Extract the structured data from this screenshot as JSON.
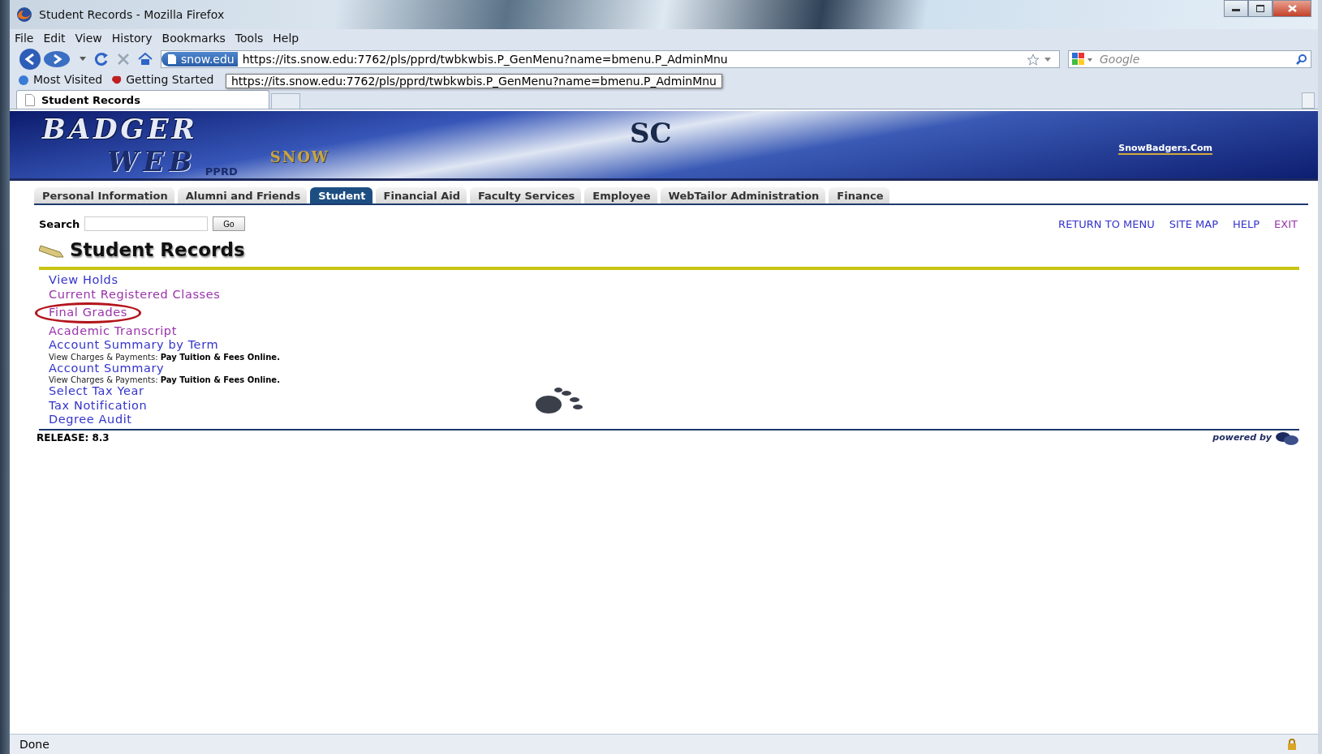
{
  "window": {
    "title": "Student Records - Mozilla Firefox"
  },
  "menu": [
    "File",
    "Edit",
    "View",
    "History",
    "Bookmarks",
    "Tools",
    "Help"
  ],
  "toolbar": {
    "site_badge": "snow.edu",
    "url": "https://its.snow.edu:7762/pls/pprd/twbkwbis.P_GenMenu?name=bmenu.P_AdminMnu",
    "search_placeholder": "Google"
  },
  "bookmarks": [
    "Most Visited",
    "Getting Started"
  ],
  "tooltip": "https://its.snow.edu:7762/pls/pprd/twbkwbis.P_GenMenu?name=bmenu.P_AdminMnu",
  "browser_tabs": [
    {
      "label": "Student Records",
      "selected": true
    }
  ],
  "banner": {
    "logo_line_1": "BADGER",
    "logo_line_2": "WEB",
    "instance": "PPRD",
    "brand": "SNOW",
    "emblem": "SC",
    "site_link": "SnowBadgers.Com"
  },
  "page_tabs": [
    {
      "label": "Personal Information",
      "selected": false
    },
    {
      "label": "Alumni and Friends",
      "selected": false
    },
    {
      "label": "Student",
      "selected": true
    },
    {
      "label": "Financial Aid",
      "selected": false
    },
    {
      "label": "Faculty Services",
      "selected": false
    },
    {
      "label": "Employee",
      "selected": false
    },
    {
      "label": "WebTailor Administration",
      "selected": false
    },
    {
      "label": "Finance",
      "selected": false
    }
  ],
  "search": {
    "label": "Search",
    "button": "Go"
  },
  "nav_links": [
    {
      "label": "RETURN TO MENU",
      "visited": false
    },
    {
      "label": "SITE MAP",
      "visited": false
    },
    {
      "label": "HELP",
      "visited": false
    },
    {
      "label": "EXIT",
      "visited": true
    }
  ],
  "heading": "Student Records",
  "links": [
    {
      "label": "View Holds",
      "visited": false,
      "circled": false
    },
    {
      "label": "Current Registered Classes",
      "visited": true,
      "circled": false
    },
    {
      "label": "Final Grades",
      "visited": true,
      "circled": true
    },
    {
      "label": "Academic Transcript",
      "visited": true,
      "circled": false
    },
    {
      "label": "Account Summary by Term",
      "visited": false,
      "circled": false,
      "note": "View Charges & Payments:  **Pay Tuition & Fees Online.**"
    },
    {
      "label": "Account Summary",
      "visited": false,
      "circled": false,
      "note": "View Charges & Payments:  **Pay Tuition & Fees Online.**"
    },
    {
      "label": "Select Tax Year",
      "visited": false,
      "circled": false
    },
    {
      "label": "Tax Notification",
      "visited": false,
      "circled": false
    },
    {
      "label": "Degree Audit",
      "visited": false,
      "circled": false
    }
  ],
  "release": "RELEASE: 8.3",
  "powered_by": "powered by",
  "status_bar": {
    "text": "Done"
  }
}
